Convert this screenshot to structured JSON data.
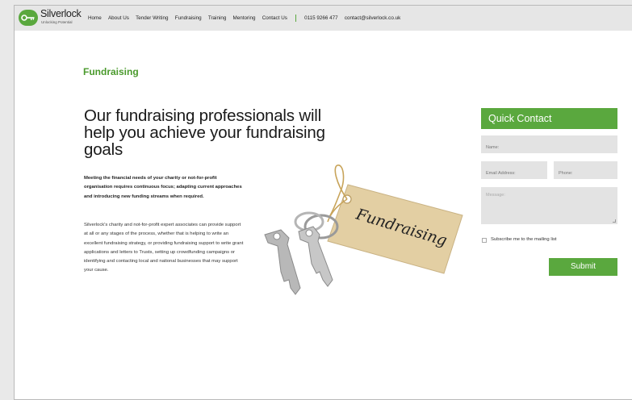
{
  "brand": {
    "name": "Silverlock",
    "tagline": "Unlocking Potential"
  },
  "nav": {
    "items": [
      "Home",
      "About Us",
      "Tender Writing",
      "Fundraising",
      "Training",
      "Mentoring",
      "Contact Us"
    ],
    "phone": "0115 9266 477",
    "email": "contact@silverlock.co.uk"
  },
  "main": {
    "section_title": "Fundraising",
    "headline": "Our fundraising professionals will help you achieve your fundraising goals",
    "lead": "Meeting the financial needs of your charity or not-for-profit organisation requires continuous focus; adapting current approaches and introducing new funding streams when required.",
    "body": "Silverlock's charity and not-for-profit expert associates can provide support at all or any stages of the process, whether that is helping to write an excellent fundraising strategy, or providing fundraising support to write grant applications and letters to Trusts, setting up crowdfunding campaigns or identifying and contacting local and national businesses that may support your cause.",
    "tag_text": "Fundraising"
  },
  "quick_contact": {
    "title": "Quick Contact",
    "name_placeholder": "Name:",
    "email_placeholder": "Email Address:",
    "phone_placeholder": "Phone:",
    "message_placeholder": "Message:",
    "subscribe_label": "Subscribe me to the mailing list",
    "subscribed": false,
    "submit_label": "Submit"
  },
  "colors": {
    "accent": "#5aa83e",
    "title_green": "#4a9a2c",
    "nav_bg": "#e6e6e6",
    "field_bg": "#e3e3e3"
  },
  "icons": [
    "key-logo-icon"
  ]
}
